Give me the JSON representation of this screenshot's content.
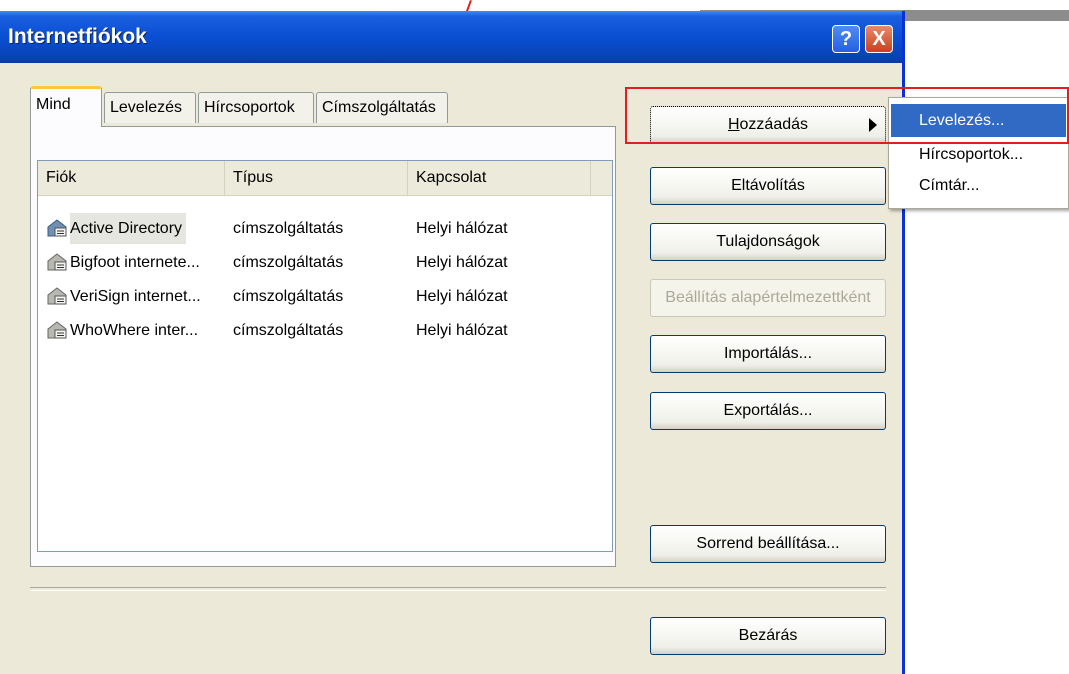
{
  "window": {
    "title": "Internetfiókok"
  },
  "titlebar": {
    "help_glyph": "?",
    "close_glyph": "X"
  },
  "tabs": [
    "Mind",
    "Levelezés",
    "Hírcsoportok",
    "Címszolgáltatás"
  ],
  "list": {
    "columns": [
      "Fiók",
      "Típus",
      "Kapcsolat"
    ],
    "rows": [
      {
        "name": "Active Directory",
        "type": "címszolgáltatás",
        "connection": "Helyi hálózat"
      },
      {
        "name": "Bigfoot internete...",
        "type": "címszolgáltatás",
        "connection": "Helyi hálózat"
      },
      {
        "name": "VeriSign internet...",
        "type": "címszolgáltatás",
        "connection": "Helyi hálózat"
      },
      {
        "name": "WhoWhere inter...",
        "type": "címszolgáltatás",
        "connection": "Helyi hálózat"
      }
    ],
    "row_icon": "directory-service-icon"
  },
  "buttons": {
    "add_prefix": "H",
    "add_rest": "ozzáadás",
    "remove": "Eltávolítás",
    "properties": "Tulajdonságok",
    "set_default": "Beállítás alapértelmezettként",
    "import": "Importálás...",
    "export": "Exportálás...",
    "order": "Sorrend beállítása...",
    "close": "Bezárás"
  },
  "submenu": {
    "items": [
      "Levelezés...",
      "Hírcsoportok...",
      "Címtár..."
    ]
  },
  "colors": {
    "titlebar": "#0a4fd3",
    "highlight": "#e02020",
    "menu_selection": "#316ac5"
  }
}
